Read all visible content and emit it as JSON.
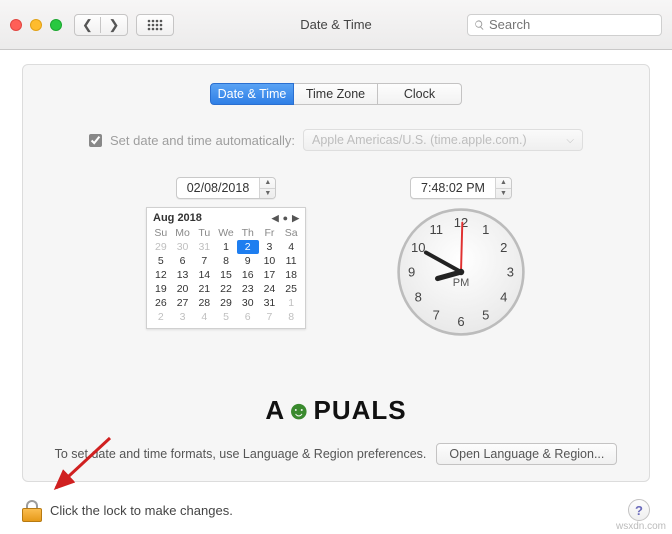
{
  "window": {
    "title": "Date & Time"
  },
  "toolbar": {
    "search_placeholder": "Search"
  },
  "tabs": {
    "date_time": "Date & Time",
    "time_zone": "Time Zone",
    "clock": "Clock"
  },
  "auto": {
    "checked": true,
    "label": "Set date and time automatically:",
    "server": "Apple Americas/U.S. (time.apple.com.)"
  },
  "date": {
    "value": "02/08/2018"
  },
  "time": {
    "value": "7:48:02 PM",
    "ampm": "PM"
  },
  "calendar": {
    "title": "Aug 2018",
    "weekdays": [
      "Su",
      "Mo",
      "Tu",
      "We",
      "Th",
      "Fr",
      "Sa"
    ],
    "leading_dim": [
      29,
      30,
      31
    ],
    "days": [
      1,
      2,
      3,
      4,
      5,
      6,
      7,
      8,
      9,
      10,
      11,
      12,
      13,
      14,
      15,
      16,
      17,
      18,
      19,
      20,
      21,
      22,
      23,
      24,
      25,
      26,
      27,
      28,
      29,
      30,
      31
    ],
    "trailing_dim": [
      1,
      2,
      3,
      4,
      5,
      6,
      7,
      8
    ],
    "selected": 2
  },
  "clockface": {
    "numbers": [
      12,
      1,
      2,
      3,
      4,
      5,
      6,
      7,
      8,
      9,
      10,
      11
    ]
  },
  "footer": {
    "text": "To set date and time formats, use Language & Region preferences.",
    "button": "Open Language & Region..."
  },
  "lock": {
    "text": "Click the lock to make changes."
  },
  "help": {
    "glyph": "?"
  },
  "watermark": {
    "text_a": "A",
    "text_b": "PUALS"
  },
  "source_note": "wsxdn.com"
}
